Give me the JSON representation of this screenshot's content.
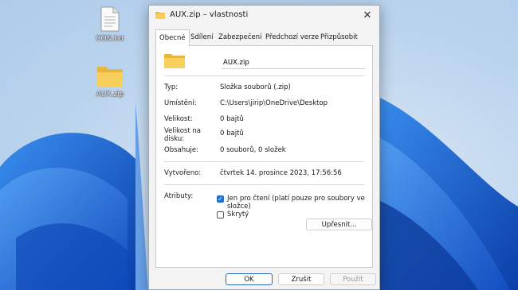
{
  "desktop": {
    "icons": [
      {
        "label": "CON.txt",
        "icon": "text-file-icon"
      },
      {
        "label": "AUX.zip",
        "icon": "folder-icon"
      }
    ]
  },
  "window": {
    "title": "AUX.zip – vlastnosti",
    "tabs": [
      "Obecné",
      "Sdílení",
      "Zabezpečení",
      "Předchozí verze",
      "Přizpůsobit"
    ],
    "active_tab": "Obecné",
    "name_value": "AUX.zip",
    "props": [
      {
        "label": "Typ:",
        "value": "Složka souborů (.zip)"
      },
      {
        "label": "Umístění:",
        "value": "C:\\Users\\jirip\\OneDrive\\Desktop"
      },
      {
        "label": "Velikost:",
        "value": "0 bajtů"
      },
      {
        "label": "Velikost na disku:",
        "value": "0 bajtů"
      },
      {
        "label": "Obsahuje:",
        "value": "0 souborů, 0 složek"
      },
      {
        "label": "Vytvořeno:",
        "value": "čtvrtek 14. prosince 2023, 17:56:56"
      }
    ],
    "attributes_label": "Atributy:",
    "readonly_label": "Jen pro čtení (platí pouze pro soubory ve složce)",
    "readonly_checked": true,
    "hidden_label": "Skrytý",
    "hidden_checked": false,
    "advanced_label": "Upřesnit...",
    "ok_label": "OK",
    "cancel_label": "Zrušit",
    "apply_label": "Použít",
    "apply_enabled": false
  },
  "colors": {
    "accent": "#1f6fc9",
    "wallpaper": "#1a5fd6"
  }
}
